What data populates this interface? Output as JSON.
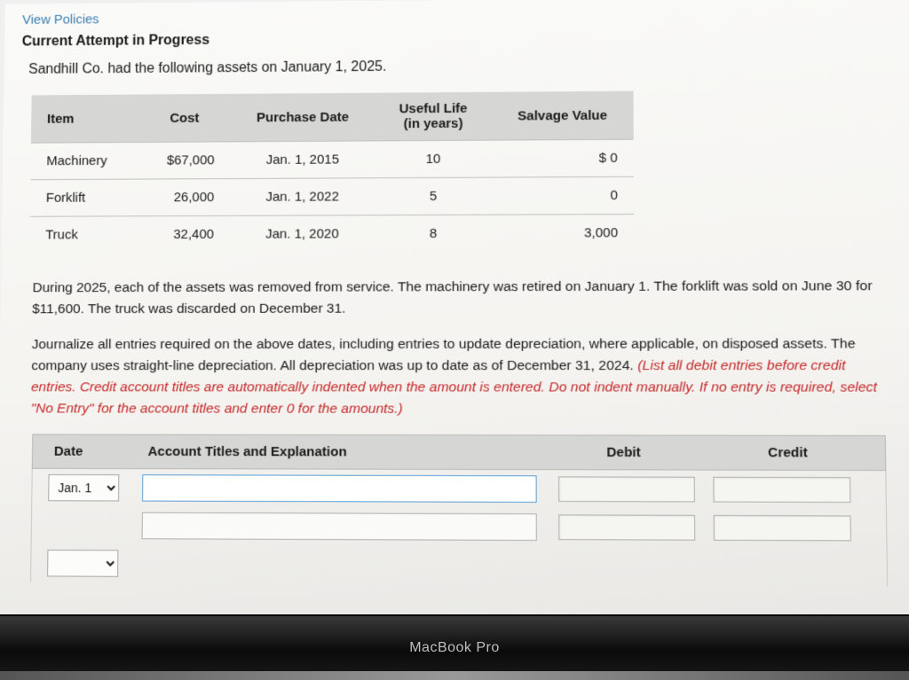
{
  "viewPolicies": "View Policies",
  "attemptHeading": "Current Attempt in Progress",
  "intro": "Sandhill Co. had the following assets on January 1, 2025.",
  "assetHeaders": {
    "item": "Item",
    "cost": "Cost",
    "purchaseDate": "Purchase Date",
    "lifeTop": "Useful Life",
    "lifeBottom": "(in years)",
    "salvage": "Salvage Value"
  },
  "assets": [
    {
      "item": "Machinery",
      "cost": "$67,000",
      "date": "Jan. 1, 2015",
      "life": "10",
      "salvage": "$ 0"
    },
    {
      "item": "Forklift",
      "cost": "26,000",
      "date": "Jan. 1, 2022",
      "life": "5",
      "salvage": "0"
    },
    {
      "item": "Truck",
      "cost": "32,400",
      "date": "Jan. 1, 2020",
      "life": "8",
      "salvage": "3,000"
    }
  ],
  "para1": "During 2025, each of the assets was removed from service. The machinery was retired on January 1. The forklift was sold on June 30 for $11,600. The truck was discarded on December 31.",
  "para2_plain": "Journalize all entries required on the above dates, including entries to update depreciation, where applicable, on disposed assets. The company uses straight-line depreciation. All depreciation was up to date as of December 31, 2024. ",
  "para2_red": "(List all debit entries before credit entries. Credit account titles are automatically indented when the amount is entered. Do not indent manually. If no entry is required, select \"No Entry\" for the account titles and enter 0 for the amounts.)",
  "journalHeaders": {
    "date": "Date",
    "acct": "Account Titles and Explanation",
    "debit": "Debit",
    "credit": "Credit"
  },
  "dateOptions": [
    "Jan. 1"
  ],
  "selectedDate": "Jan. 1",
  "bezel": "MacBook Pro"
}
